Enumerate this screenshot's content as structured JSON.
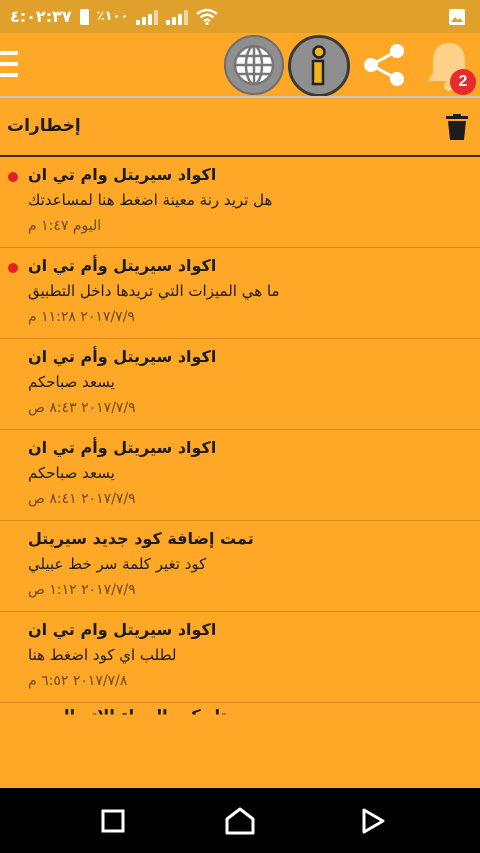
{
  "status_bar": {
    "time": "٤:٠٢:٣٧",
    "battery": "٪١٠٠",
    "icons": [
      "gallery-icon",
      "wifi-icon",
      "signal-icon",
      "signal-icon",
      "battery-icon"
    ]
  },
  "app_bar": {
    "badge_count": "2",
    "buttons": [
      "menu-icon",
      "globe-icon",
      "info-icon",
      "share-icon",
      "bell-icon"
    ],
    "colors": {
      "accent": "#ffa726",
      "status": "#e0a12c",
      "badge": "#e52b2b",
      "unread_dot": "#e52020"
    }
  },
  "notifications": {
    "header": "إخطارات",
    "items": [
      {
        "title": "اكواد سيريتل وام تي ان",
        "message": "هل تريد رنة معينة اضغط هنا لمساعدتك",
        "time": "اليوم ١:٤٧ م",
        "unread": true
      },
      {
        "title": "اكواد سيريتل وأم تي ان",
        "message": "ما هي الميزات التي تريدها داخل التطبيق",
        "time": "٢٠١٧/٧/٩ ١١:٢٨ م",
        "unread": true
      },
      {
        "title": "اكواد سيريتل وأم تي ان",
        "message": "يسعد صباحكم",
        "time": "٢٠١٧/٧/٩ ٨:٤٣ ص",
        "unread": false
      },
      {
        "title": "اكواد سيريتل وأم تي ان",
        "message": "يسعد صباحكم",
        "time": "٢٠١٧/٧/٩ ٨:٤١ ص",
        "unread": false
      },
      {
        "title": "تمت إضافة كود جديد سيريتل",
        "message": "كود تغير كلمة سر خط عبيلي",
        "time": "٢٠١٧/٧/٩ ١:١٢ ص",
        "unread": false
      },
      {
        "title": "اكواد سيريتل وام تي ان",
        "message": "لطلب اي كود اضغط هنا",
        "time": "٢٠١٧/٧/٨ ٦:٥٢ م",
        "unread": false
      },
      {
        "title": "سيريتل كود الرجاء الاتصال بي",
        "message": "",
        "time": "",
        "unread": false
      }
    ]
  },
  "nav_bar": {
    "buttons": [
      "recents-icon",
      "home-icon",
      "back-icon"
    ]
  }
}
